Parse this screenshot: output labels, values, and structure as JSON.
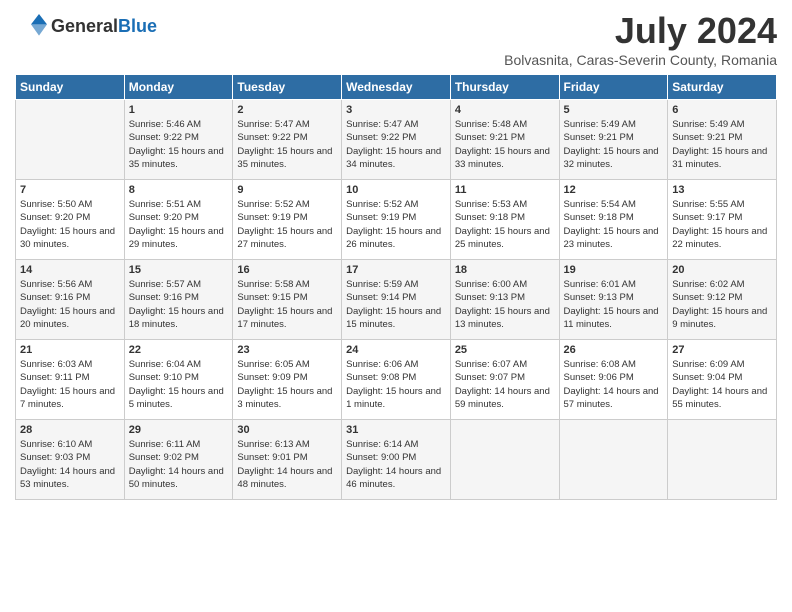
{
  "header": {
    "logo_general": "General",
    "logo_blue": "Blue",
    "title": "July 2024",
    "subtitle": "Bolvasnita, Caras-Severin County, Romania"
  },
  "days_of_week": [
    "Sunday",
    "Monday",
    "Tuesday",
    "Wednesday",
    "Thursday",
    "Friday",
    "Saturday"
  ],
  "weeks": [
    [
      {
        "day": "",
        "sunrise": "",
        "sunset": "",
        "daylight": ""
      },
      {
        "day": "1",
        "sunrise": "Sunrise: 5:46 AM",
        "sunset": "Sunset: 9:22 PM",
        "daylight": "Daylight: 15 hours and 35 minutes."
      },
      {
        "day": "2",
        "sunrise": "Sunrise: 5:47 AM",
        "sunset": "Sunset: 9:22 PM",
        "daylight": "Daylight: 15 hours and 35 minutes."
      },
      {
        "day": "3",
        "sunrise": "Sunrise: 5:47 AM",
        "sunset": "Sunset: 9:22 PM",
        "daylight": "Daylight: 15 hours and 34 minutes."
      },
      {
        "day": "4",
        "sunrise": "Sunrise: 5:48 AM",
        "sunset": "Sunset: 9:21 PM",
        "daylight": "Daylight: 15 hours and 33 minutes."
      },
      {
        "day": "5",
        "sunrise": "Sunrise: 5:49 AM",
        "sunset": "Sunset: 9:21 PM",
        "daylight": "Daylight: 15 hours and 32 minutes."
      },
      {
        "day": "6",
        "sunrise": "Sunrise: 5:49 AM",
        "sunset": "Sunset: 9:21 PM",
        "daylight": "Daylight: 15 hours and 31 minutes."
      }
    ],
    [
      {
        "day": "7",
        "sunrise": "Sunrise: 5:50 AM",
        "sunset": "Sunset: 9:20 PM",
        "daylight": "Daylight: 15 hours and 30 minutes."
      },
      {
        "day": "8",
        "sunrise": "Sunrise: 5:51 AM",
        "sunset": "Sunset: 9:20 PM",
        "daylight": "Daylight: 15 hours and 29 minutes."
      },
      {
        "day": "9",
        "sunrise": "Sunrise: 5:52 AM",
        "sunset": "Sunset: 9:19 PM",
        "daylight": "Daylight: 15 hours and 27 minutes."
      },
      {
        "day": "10",
        "sunrise": "Sunrise: 5:52 AM",
        "sunset": "Sunset: 9:19 PM",
        "daylight": "Daylight: 15 hours and 26 minutes."
      },
      {
        "day": "11",
        "sunrise": "Sunrise: 5:53 AM",
        "sunset": "Sunset: 9:18 PM",
        "daylight": "Daylight: 15 hours and 25 minutes."
      },
      {
        "day": "12",
        "sunrise": "Sunrise: 5:54 AM",
        "sunset": "Sunset: 9:18 PM",
        "daylight": "Daylight: 15 hours and 23 minutes."
      },
      {
        "day": "13",
        "sunrise": "Sunrise: 5:55 AM",
        "sunset": "Sunset: 9:17 PM",
        "daylight": "Daylight: 15 hours and 22 minutes."
      }
    ],
    [
      {
        "day": "14",
        "sunrise": "Sunrise: 5:56 AM",
        "sunset": "Sunset: 9:16 PM",
        "daylight": "Daylight: 15 hours and 20 minutes."
      },
      {
        "day": "15",
        "sunrise": "Sunrise: 5:57 AM",
        "sunset": "Sunset: 9:16 PM",
        "daylight": "Daylight: 15 hours and 18 minutes."
      },
      {
        "day": "16",
        "sunrise": "Sunrise: 5:58 AM",
        "sunset": "Sunset: 9:15 PM",
        "daylight": "Daylight: 15 hours and 17 minutes."
      },
      {
        "day": "17",
        "sunrise": "Sunrise: 5:59 AM",
        "sunset": "Sunset: 9:14 PM",
        "daylight": "Daylight: 15 hours and 15 minutes."
      },
      {
        "day": "18",
        "sunrise": "Sunrise: 6:00 AM",
        "sunset": "Sunset: 9:13 PM",
        "daylight": "Daylight: 15 hours and 13 minutes."
      },
      {
        "day": "19",
        "sunrise": "Sunrise: 6:01 AM",
        "sunset": "Sunset: 9:13 PM",
        "daylight": "Daylight: 15 hours and 11 minutes."
      },
      {
        "day": "20",
        "sunrise": "Sunrise: 6:02 AM",
        "sunset": "Sunset: 9:12 PM",
        "daylight": "Daylight: 15 hours and 9 minutes."
      }
    ],
    [
      {
        "day": "21",
        "sunrise": "Sunrise: 6:03 AM",
        "sunset": "Sunset: 9:11 PM",
        "daylight": "Daylight: 15 hours and 7 minutes."
      },
      {
        "day": "22",
        "sunrise": "Sunrise: 6:04 AM",
        "sunset": "Sunset: 9:10 PM",
        "daylight": "Daylight: 15 hours and 5 minutes."
      },
      {
        "day": "23",
        "sunrise": "Sunrise: 6:05 AM",
        "sunset": "Sunset: 9:09 PM",
        "daylight": "Daylight: 15 hours and 3 minutes."
      },
      {
        "day": "24",
        "sunrise": "Sunrise: 6:06 AM",
        "sunset": "Sunset: 9:08 PM",
        "daylight": "Daylight: 15 hours and 1 minute."
      },
      {
        "day": "25",
        "sunrise": "Sunrise: 6:07 AM",
        "sunset": "Sunset: 9:07 PM",
        "daylight": "Daylight: 14 hours and 59 minutes."
      },
      {
        "day": "26",
        "sunrise": "Sunrise: 6:08 AM",
        "sunset": "Sunset: 9:06 PM",
        "daylight": "Daylight: 14 hours and 57 minutes."
      },
      {
        "day": "27",
        "sunrise": "Sunrise: 6:09 AM",
        "sunset": "Sunset: 9:04 PM",
        "daylight": "Daylight: 14 hours and 55 minutes."
      }
    ],
    [
      {
        "day": "28",
        "sunrise": "Sunrise: 6:10 AM",
        "sunset": "Sunset: 9:03 PM",
        "daylight": "Daylight: 14 hours and 53 minutes."
      },
      {
        "day": "29",
        "sunrise": "Sunrise: 6:11 AM",
        "sunset": "Sunset: 9:02 PM",
        "daylight": "Daylight: 14 hours and 50 minutes."
      },
      {
        "day": "30",
        "sunrise": "Sunrise: 6:13 AM",
        "sunset": "Sunset: 9:01 PM",
        "daylight": "Daylight: 14 hours and 48 minutes."
      },
      {
        "day": "31",
        "sunrise": "Sunrise: 6:14 AM",
        "sunset": "Sunset: 9:00 PM",
        "daylight": "Daylight: 14 hours and 46 minutes."
      },
      {
        "day": "",
        "sunrise": "",
        "sunset": "",
        "daylight": ""
      },
      {
        "day": "",
        "sunrise": "",
        "sunset": "",
        "daylight": ""
      },
      {
        "day": "",
        "sunrise": "",
        "sunset": "",
        "daylight": ""
      }
    ]
  ]
}
